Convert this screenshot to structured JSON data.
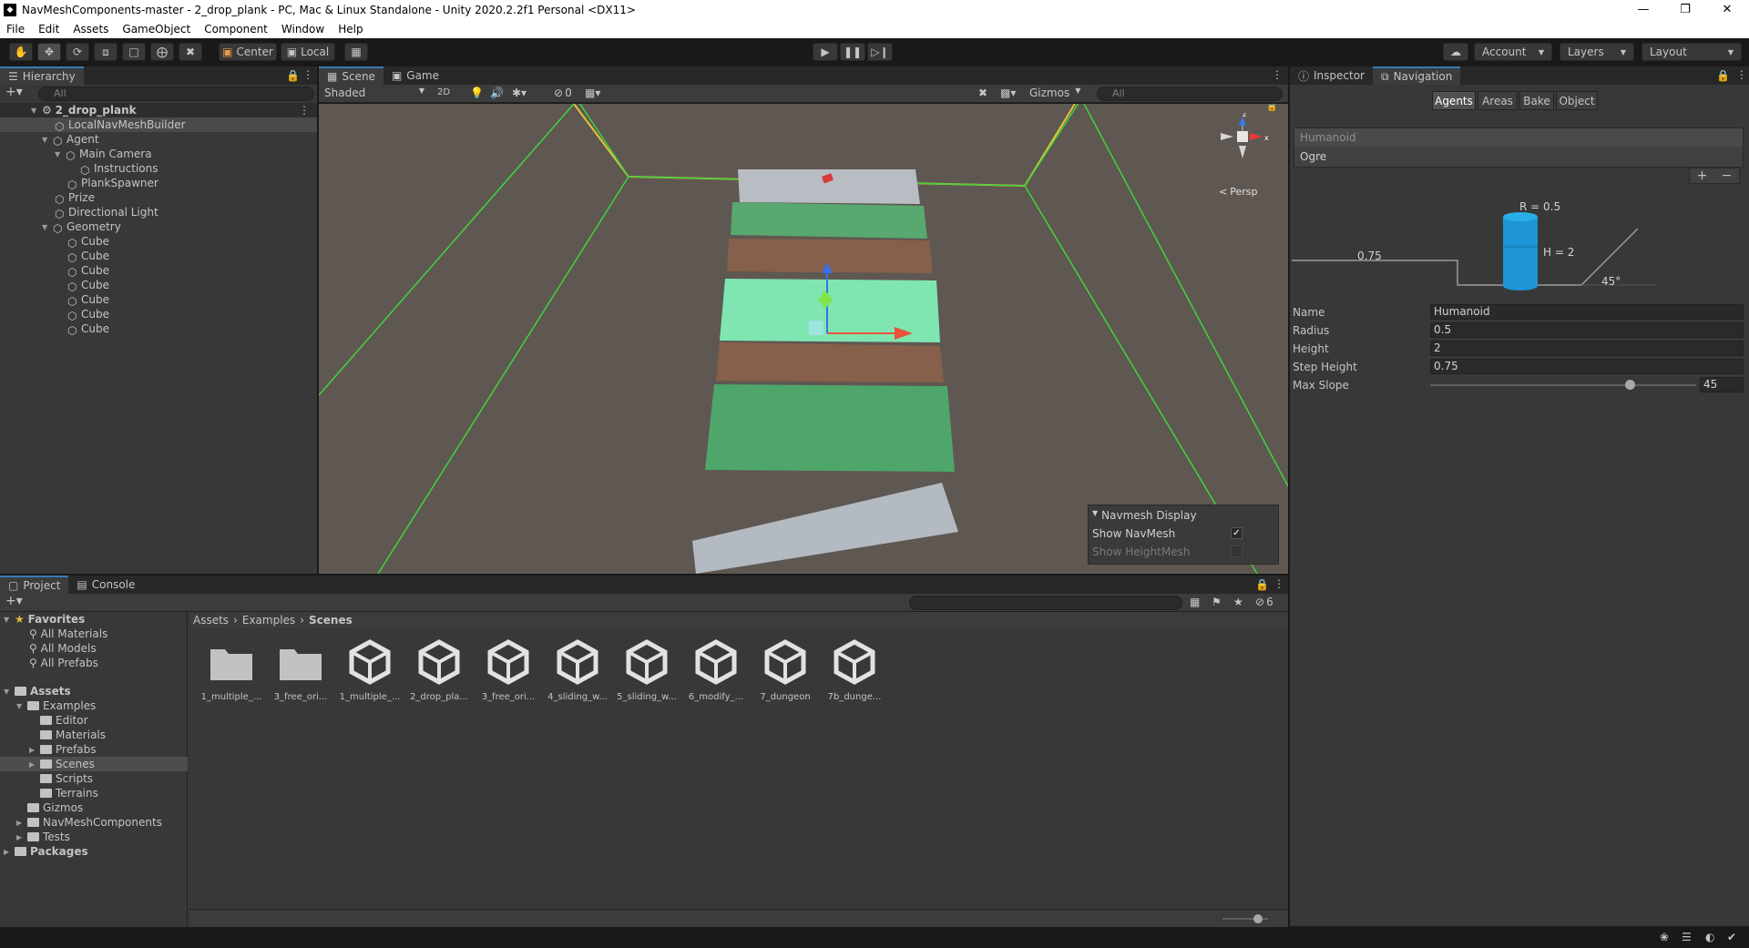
{
  "window": {
    "title": "NavMeshComponents-master - 2_drop_plank - PC, Mac & Linux Standalone - Unity 2020.2.2f1 Personal <DX11>"
  },
  "menu": [
    "File",
    "Edit",
    "Assets",
    "GameObject",
    "Component",
    "Window",
    "Help"
  ],
  "toolbar": {
    "center_label": "Center",
    "local_label": "Local",
    "account_label": "Account",
    "layers_label": "Layers",
    "layout_label": "Layout"
  },
  "hierarchy": {
    "tab": "Hierarchy",
    "search_placeholder": "All",
    "scene": "2_drop_plank",
    "items": [
      "LocalNavMeshBuilder",
      "Agent",
      "Main Camera",
      "Instructions",
      "PlankSpawner",
      "Prize",
      "Directional Light",
      "Geometry",
      "Cube",
      "Cube",
      "Cube",
      "Cube",
      "Cube",
      "Cube",
      "Cube"
    ]
  },
  "scene": {
    "tabs": [
      "Scene",
      "Game"
    ],
    "shading": "Shaded",
    "mode2d": "2D",
    "hidden_count": "0",
    "gizmos": "Gizmos",
    "search_placeholder": "All",
    "persp": "Persp",
    "navmesh_display": {
      "title": "Navmesh Display",
      "show_navmesh": "Show NavMesh",
      "show_heightmesh": "Show HeightMesh",
      "show_navmesh_checked": true,
      "show_heightmesh_checked": false
    }
  },
  "inspector": {
    "tabs": [
      "Inspector",
      "Navigation"
    ],
    "nav_tabs": [
      "Agents",
      "Areas",
      "Bake",
      "Object"
    ],
    "agents": [
      "Humanoid",
      "Ogre"
    ],
    "diagram": {
      "r_label": "R = 0.5",
      "h_label": "H = 2",
      "step_label": "0.75",
      "slope_label": "45°"
    },
    "fields": {
      "name_label": "Name",
      "name_value": "Humanoid",
      "radius_label": "Radius",
      "radius_value": "0.5",
      "height_label": "Height",
      "height_value": "2",
      "step_label": "Step Height",
      "step_value": "0.75",
      "slope_label": "Max Slope",
      "slope_value": "45"
    },
    "slope_fraction": 0.75
  },
  "project": {
    "tabs": [
      "Project",
      "Console"
    ],
    "hidden_count": "6",
    "favorites_label": "Favorites",
    "favorites": [
      "All Materials",
      "All Models",
      "All Prefabs"
    ],
    "assets_label": "Assets",
    "tree": [
      "Examples",
      "Editor",
      "Materials",
      "Prefabs",
      "Scenes",
      "Scripts",
      "Terrains",
      "Gizmos",
      "NavMeshComponents",
      "Tests"
    ],
    "packages_label": "Packages",
    "breadcrumb": [
      "Assets",
      "Examples",
      "Scenes"
    ],
    "files": [
      {
        "label": "1_multiple_...",
        "kind": "folder"
      },
      {
        "label": "3_free_ori...",
        "kind": "folder"
      },
      {
        "label": "1_multiple_...",
        "kind": "unity"
      },
      {
        "label": "2_drop_pla...",
        "kind": "unity"
      },
      {
        "label": "3_free_ori...",
        "kind": "unity"
      },
      {
        "label": "4_sliding_w...",
        "kind": "unity"
      },
      {
        "label": "5_sliding_w...",
        "kind": "unity"
      },
      {
        "label": "6_modify_...",
        "kind": "unity"
      },
      {
        "label": "7_dungeon",
        "kind": "unity"
      },
      {
        "label": "7b_dunge...",
        "kind": "unity"
      }
    ]
  },
  "colors": {
    "accent": "#3a79bb",
    "selection": "#2c5d87",
    "navmesh": "#78e6b4"
  }
}
